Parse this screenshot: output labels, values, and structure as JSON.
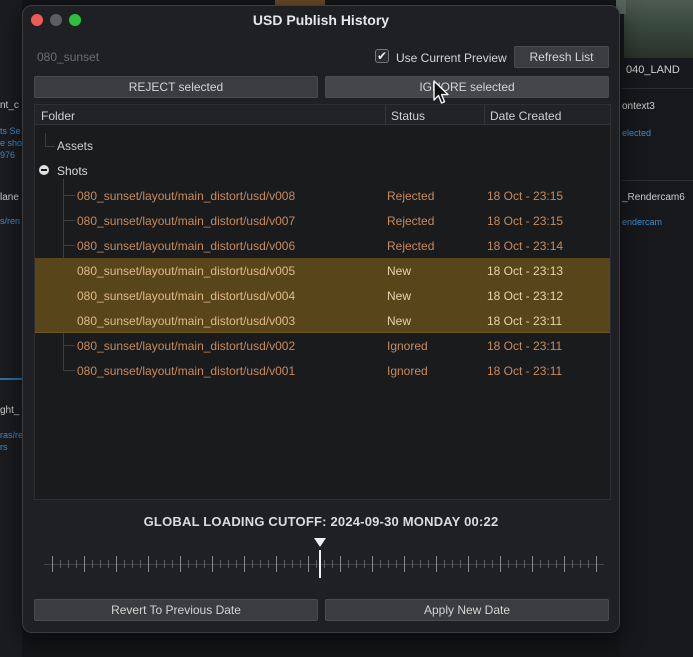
{
  "window": {
    "title": "USD Publish History"
  },
  "toolbar": {
    "shot_name": "080_sunset",
    "use_current_preview_label": "Use Current Preview",
    "use_current_preview_checked": true,
    "refresh_label": "Refresh List",
    "reject_label": "REJECT selected",
    "ignore_label": "IGNORE selected"
  },
  "tree": {
    "columns": [
      "Folder",
      "Status",
      "Date Created"
    ],
    "groups": [
      {
        "label": "Assets",
        "expanded": false
      },
      {
        "label": "Shots",
        "expanded": true
      }
    ],
    "rows": [
      {
        "folder": "080_sunset/layout/main_distort/usd/v008",
        "status": "Rejected",
        "date": "18 Oct - 23:15",
        "selected": false
      },
      {
        "folder": "080_sunset/layout/main_distort/usd/v007",
        "status": "Rejected",
        "date": "18 Oct - 23:15",
        "selected": false
      },
      {
        "folder": "080_sunset/layout/main_distort/usd/v006",
        "status": "Rejected",
        "date": "18 Oct - 23:14",
        "selected": false
      },
      {
        "folder": "080_sunset/layout/main_distort/usd/v005",
        "status": "New",
        "date": "18 Oct - 23:13",
        "selected": true
      },
      {
        "folder": "080_sunset/layout/main_distort/usd/v004",
        "status": "New",
        "date": "18 Oct - 23:12",
        "selected": true
      },
      {
        "folder": "080_sunset/layout/main_distort/usd/v003",
        "status": "New",
        "date": "18 Oct - 23:11",
        "selected": true
      },
      {
        "folder": "080_sunset/layout/main_distort/usd/v002",
        "status": "Ignored",
        "date": "18 Oct - 23:11",
        "selected": false
      },
      {
        "folder": "080_sunset/layout/main_distort/usd/v001",
        "status": "Ignored",
        "date": "18 Oct - 23:11",
        "selected": false
      }
    ]
  },
  "cutoff": {
    "label": "GLOBAL LOADING CUTOFF: 2024-09-30 MONDAY 00:22"
  },
  "footer": {
    "revert_label": "Revert To Previous Date",
    "apply_label": "Apply New Date"
  },
  "background": {
    "right_labels": [
      "040_LAND",
      "ontext3",
      "elected",
      "_Rendercam6",
      "endercam"
    ],
    "left_labels": [
      "nt_c",
      "lane",
      "ght_",
      "ts Se",
      "e sho",
      "976",
      "s/ren",
      "ras/re",
      "rs"
    ]
  },
  "colors": {
    "selection": "#59451a",
    "row_text": "#c98a5c",
    "row_text_selected": "#e6d3b0",
    "close": "#ee5b56",
    "zoom": "#2dc03f"
  },
  "icons": [
    "close-icon",
    "minimize-icon",
    "zoom-icon",
    "checkmark-icon",
    "collapse-icon",
    "mouse-cursor-icon",
    "cutoff-marker-icon"
  ]
}
